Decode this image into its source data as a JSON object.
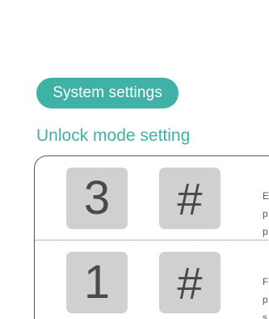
{
  "header": {
    "pill_label": "System settings",
    "section_title": "Unlock mode setting"
  },
  "rows": [
    {
      "keys": [
        "3",
        "#"
      ],
      "desc_lines": [
        "E",
        "p",
        "p"
      ]
    },
    {
      "keys": [
        "1",
        "#"
      ],
      "desc_lines": [
        "F",
        "p",
        "s"
      ]
    }
  ],
  "colors": {
    "accent": "#3fb1a7",
    "key_bg": "#cfd0d1",
    "key_text": "#4a4a4a"
  }
}
